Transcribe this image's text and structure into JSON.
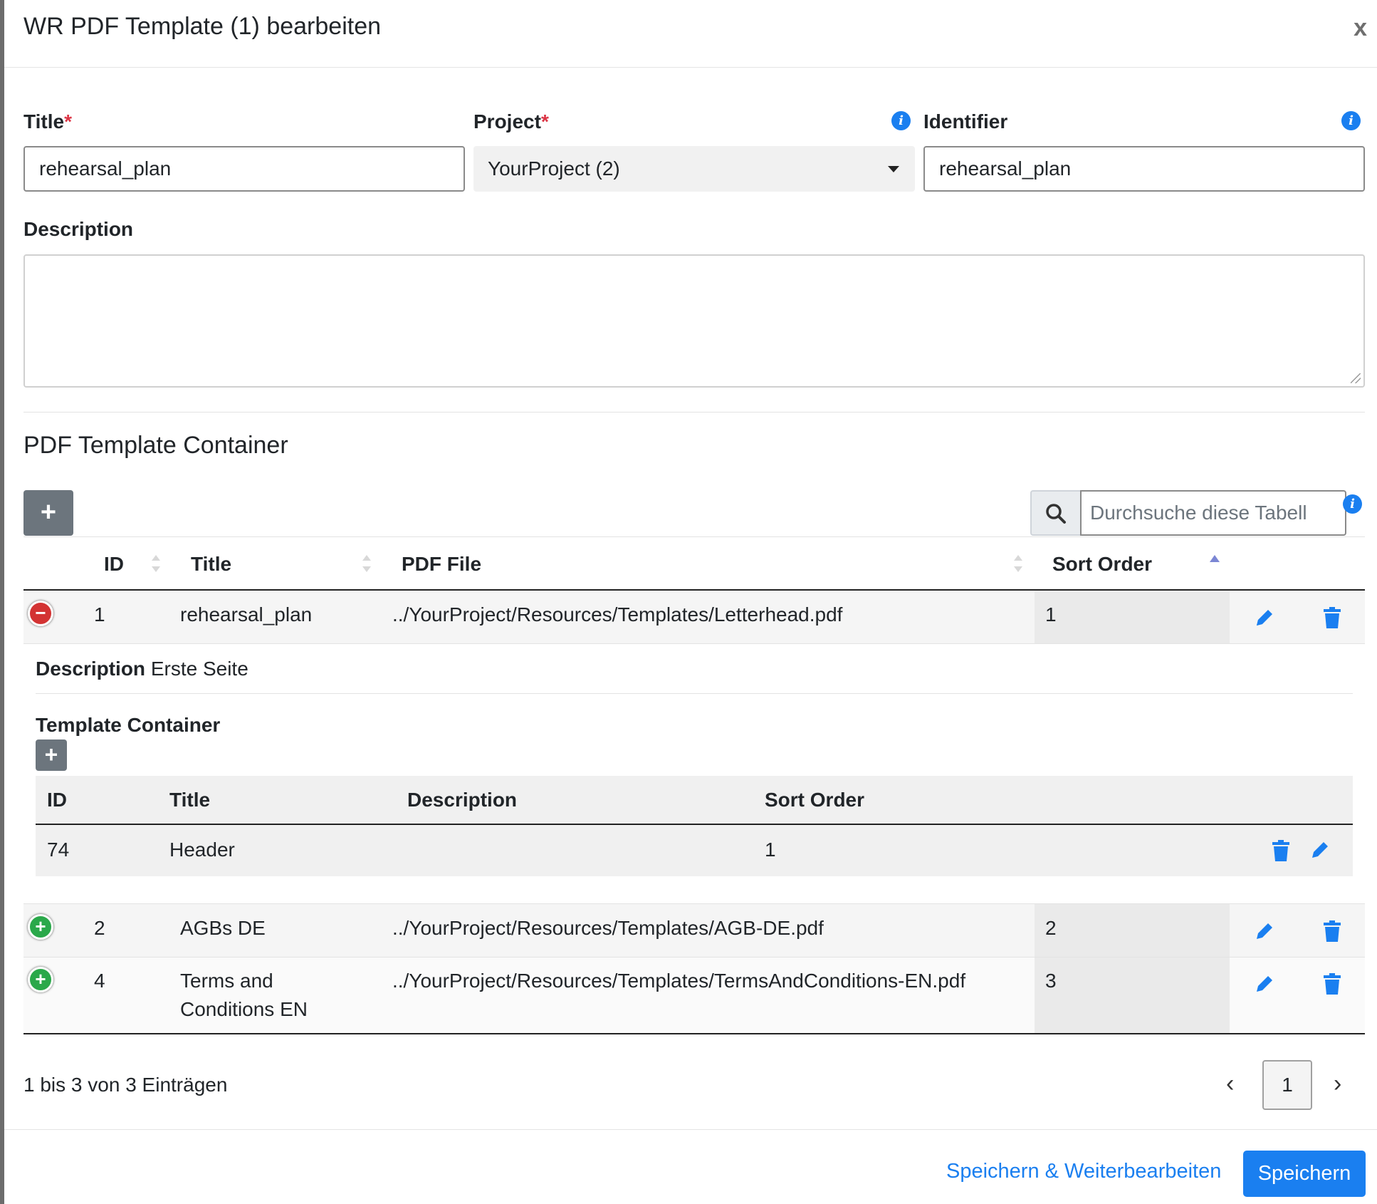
{
  "header": {
    "title": "WR PDF Template (1) bearbeiten",
    "close_label": "x"
  },
  "form": {
    "title_label": "Title",
    "title_value": "rehearsal_plan",
    "project_label": "Project",
    "project_value": "YourProject (2)",
    "identifier_label": "Identifier",
    "identifier_value": "rehearsal_plan",
    "description_label": "Description",
    "required_mark": "*"
  },
  "container": {
    "section_title": "PDF Template Container",
    "search_placeholder": "Durchsuche diese Tabell",
    "columns": [
      "ID",
      "Title",
      "PDF File",
      "Sort Order"
    ],
    "rows": [
      {
        "id": "1",
        "title": "rehearsal_plan",
        "file": "../YourProject/Resources/Templates/Letterhead.pdf",
        "sort": "1",
        "expanded": true
      },
      {
        "id": "2",
        "title": "AGBs DE",
        "file": "../YourProject/Resources/Templates/AGB-DE.pdf",
        "sort": "2",
        "expanded": false
      },
      {
        "id": "4",
        "title_line1": "Terms and",
        "title_line2": "Conditions EN",
        "file": "../YourProject/Resources/Templates/TermsAndConditions-EN.pdf",
        "sort": "3",
        "expanded": false
      }
    ],
    "detail": {
      "description_label": "Description",
      "description_value": "Erste Seite",
      "sub_title": "Template Container",
      "sub_columns": [
        "ID",
        "Title",
        "Description",
        "Sort Order"
      ],
      "sub_row": {
        "id": "74",
        "title": "Header",
        "description": "",
        "sort": "1"
      }
    },
    "info_text": "1 bis 3 von 3 Einträgen",
    "current_page": "1"
  },
  "footer": {
    "save_continue_label": "Speichern & Weiterbearbeiten",
    "save_label": "Speichern"
  },
  "colors": {
    "primary": "#1a7ff0",
    "required": "#dc3545",
    "danger_toggle": "#d33333",
    "success_toggle": "#2aa84a",
    "add_button": "#6c757d"
  }
}
